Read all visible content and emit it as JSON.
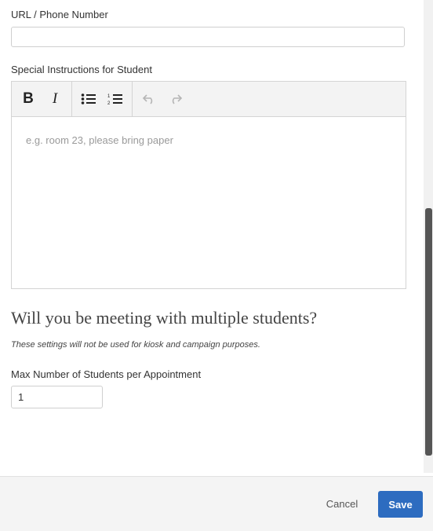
{
  "url_field": {
    "label": "URL / Phone Number",
    "value": ""
  },
  "instructions": {
    "label": "Special Instructions for Student",
    "placeholder": "e.g. room 23, please bring paper",
    "toolbar": {
      "bold_label": "B",
      "italic_label": "I",
      "icons": [
        "bold-icon",
        "italic-icon",
        "bullet-list-icon",
        "numbered-list-icon",
        "undo-icon",
        "redo-icon"
      ]
    }
  },
  "multi": {
    "heading": "Will you be meeting with multiple students?",
    "note": "These settings will not be used for kiosk and campaign purposes.",
    "max_label": "Max Number of Students per Appointment",
    "max_value": "1"
  },
  "footer": {
    "cancel_label": "Cancel",
    "save_label": "Save"
  },
  "colors": {
    "save_button": "#2d6cc0",
    "footer_bg": "#f4f4f4"
  }
}
